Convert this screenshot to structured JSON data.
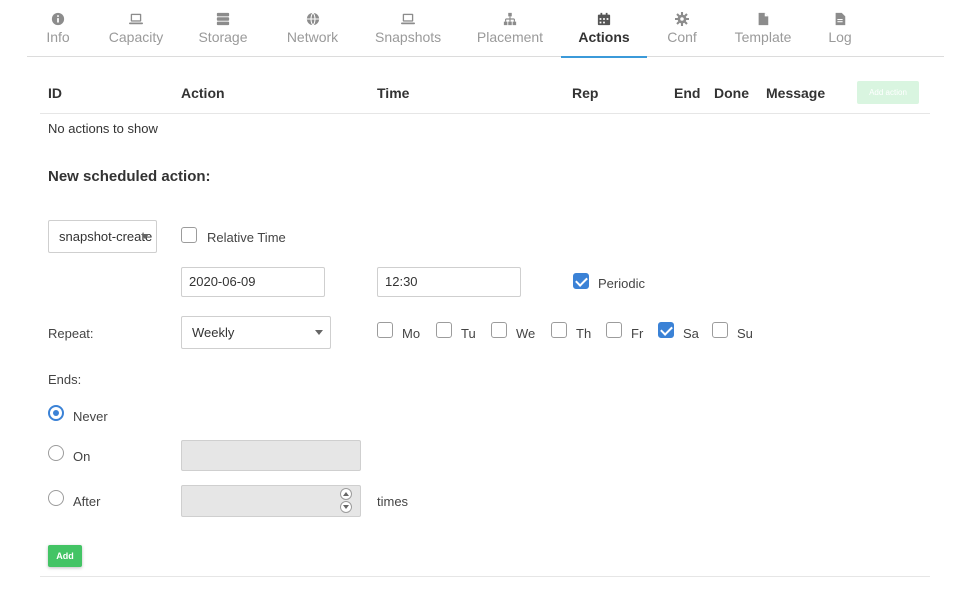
{
  "tabs": [
    {
      "label": "Info",
      "icon": "info-icon"
    },
    {
      "label": "Capacity",
      "icon": "laptop-icon"
    },
    {
      "label": "Storage",
      "icon": "server-icon"
    },
    {
      "label": "Network",
      "icon": "globe-icon"
    },
    {
      "label": "Snapshots",
      "icon": "laptop-icon"
    },
    {
      "label": "Placement",
      "icon": "sitemap-icon"
    },
    {
      "label": "Actions",
      "icon": "calendar-icon",
      "active": true
    },
    {
      "label": "Conf",
      "icon": "gear-icon"
    },
    {
      "label": "Template",
      "icon": "file-icon"
    },
    {
      "label": "Log",
      "icon": "file-text-icon"
    }
  ],
  "table": {
    "headers": [
      "ID",
      "Action",
      "Time",
      "Rep",
      "End",
      "Done",
      "Message"
    ],
    "add_action_label": "Add action",
    "empty_text": "No actions to show"
  },
  "form": {
    "title": "New scheduled action:",
    "action_select": "snapshot-create",
    "relative_time_label": "Relative Time",
    "date": "2020-06-09",
    "time": "12:30",
    "periodic_label": "Periodic",
    "repeat_label": "Repeat:",
    "repeat_value": "Weekly",
    "days": [
      {
        "label": "Mo",
        "checked": false
      },
      {
        "label": "Tu",
        "checked": false
      },
      {
        "label": "We",
        "checked": false
      },
      {
        "label": "Th",
        "checked": false
      },
      {
        "label": "Fr",
        "checked": false
      },
      {
        "label": "Sa",
        "checked": true
      },
      {
        "label": "Su",
        "checked": false
      }
    ],
    "ends_label": "Ends:",
    "never_label": "Never",
    "on_label": "On",
    "after_label": "After",
    "times_label": "times",
    "add_label": "Add"
  },
  "colors": {
    "accent": "#3b9ad9",
    "checkbox": "#3b82d6",
    "add_button": "#43c465"
  }
}
